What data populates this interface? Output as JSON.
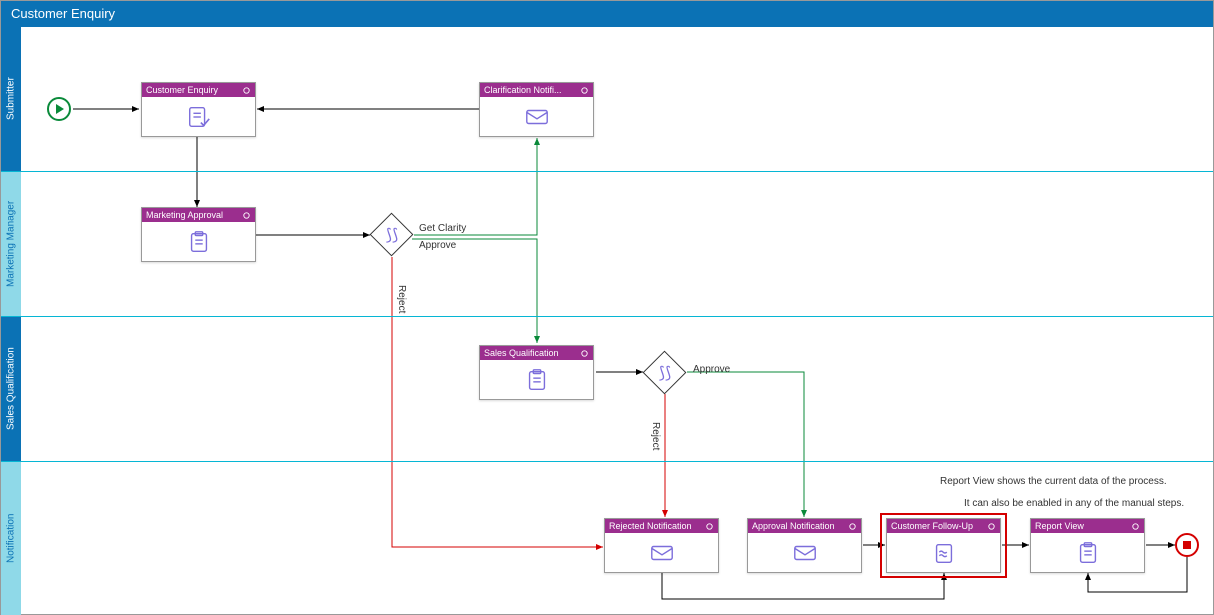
{
  "header": {
    "title": "Customer Enquiry"
  },
  "lanes": {
    "submitter": {
      "label": "Submitter",
      "color": "#0B72B5"
    },
    "marketing": {
      "label": "Marketing Manager",
      "color": "#6ccde0"
    },
    "sales": {
      "label": "Sales Qualification",
      "color": "#0B72B5"
    },
    "notification": {
      "label": "Notification",
      "color": "#6ccde0"
    }
  },
  "nodes": {
    "customer_enquiry": {
      "label": "Customer Enquiry"
    },
    "clarification": {
      "label": "Clarification Notifi..."
    },
    "marketing_approval": {
      "label": "Marketing Approval"
    },
    "sales_qual": {
      "label": "Sales Qualification"
    },
    "rejected": {
      "label": "Rejected Notification"
    },
    "approval_notif": {
      "label": "Approval Notification"
    },
    "follow_up": {
      "label": "Customer Follow-Up"
    },
    "report_view": {
      "label": "Report View"
    }
  },
  "labels": {
    "get_clarity": "Get Clarity",
    "approve": "Approve",
    "reject": "Reject",
    "approve2": "Approve",
    "reject2": "Reject"
  },
  "hints": {
    "line1": "Report View shows the current data of the process.",
    "line2": "It can also be enabled in any of the manual steps."
  }
}
